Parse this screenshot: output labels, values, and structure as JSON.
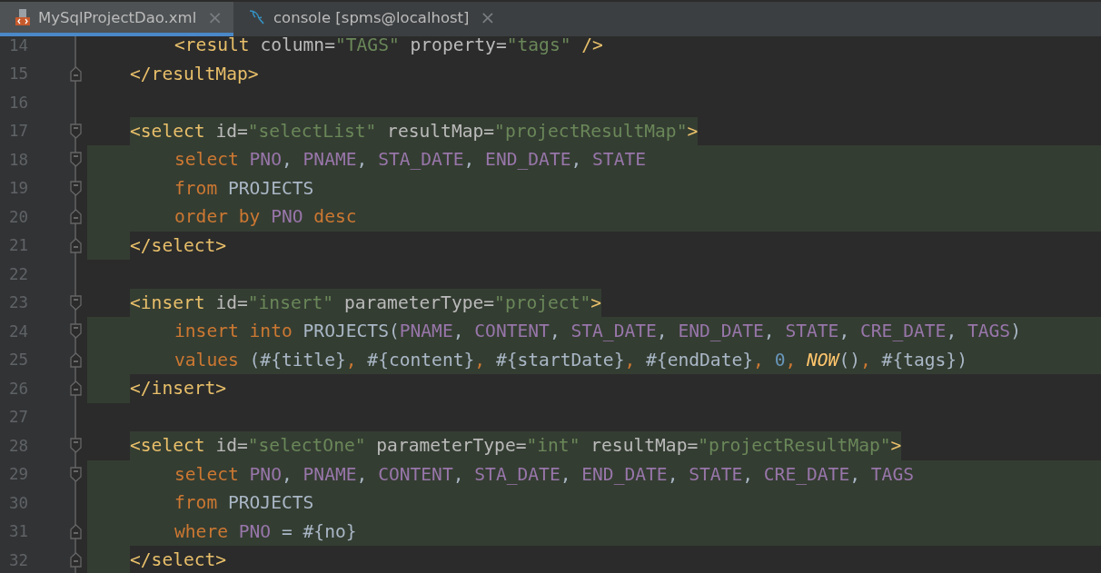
{
  "tabs": [
    {
      "label": "MySqlProjectDao.xml",
      "selected": true,
      "close": "×"
    },
    {
      "label": "console [spms@localhost]",
      "selected": false,
      "close": "×"
    }
  ],
  "lines": [
    {
      "number": "14",
      "kind": "inner",
      "tokens": [
        {
          "kind": "tag",
          "text": "<result "
        },
        {
          "kind": "attr",
          "text": "column="
        },
        {
          "kind": "value",
          "text": "\"TAGS\""
        },
        {
          "kind": "attr",
          "text": " property="
        },
        {
          "kind": "value",
          "text": "\"tags\""
        },
        {
          "kind": "tag",
          "text": " />"
        }
      ]
    },
    {
      "number": "15",
      "kind": "outer",
      "marker": {
        "kind": "end"
      },
      "tokens": [
        {
          "kind": "tag",
          "text": "</resultMap>"
        }
      ]
    },
    {
      "number": "16"
    },
    {
      "number": "17",
      "kind": "outer",
      "marker": {
        "kind": "start"
      },
      "shade": {
        "kind": "tag"
      },
      "tokens": [
        {
          "kind": "tag",
          "text": "<select "
        },
        {
          "kind": "attr",
          "text": "id="
        },
        {
          "kind": "value",
          "text": "\"selectList\""
        },
        {
          "kind": "attr",
          "text": " resultMap="
        },
        {
          "kind": "value",
          "text": "\"projectResultMap\""
        },
        {
          "kind": "tag",
          "text": ">"
        }
      ]
    },
    {
      "number": "18",
      "kind": "inner",
      "marker": {
        "kind": "start"
      },
      "shade": {
        "kind": "full"
      },
      "tokens": [
        {
          "kind": "keyword",
          "text": "select "
        },
        {
          "kind": "column",
          "text": "PNO"
        },
        {
          "kind": "text",
          "text": ", "
        },
        {
          "kind": "column",
          "text": "PNAME"
        },
        {
          "kind": "text",
          "text": ", "
        },
        {
          "kind": "column",
          "text": "STA_DATE"
        },
        {
          "kind": "text",
          "text": ", "
        },
        {
          "kind": "column",
          "text": "END_DATE"
        },
        {
          "kind": "text",
          "text": ", "
        },
        {
          "kind": "column",
          "text": "STATE"
        }
      ]
    },
    {
      "number": "19",
      "kind": "inner",
      "marker": {
        "kind": "start"
      },
      "shade": {
        "kind": "full"
      },
      "tokens": [
        {
          "kind": "keyword",
          "text": "from "
        },
        {
          "kind": "text",
          "text": "PROJECTS"
        }
      ]
    },
    {
      "number": "20",
      "kind": "inner",
      "marker": {
        "kind": "end"
      },
      "shade": {
        "kind": "full"
      },
      "tokens": [
        {
          "kind": "keyword",
          "text": "order by "
        },
        {
          "kind": "column",
          "text": "PNO"
        },
        {
          "kind": "keyword",
          "text": " desc"
        }
      ]
    },
    {
      "number": "21",
      "kind": "outer",
      "marker": {
        "kind": "end"
      },
      "shade": {
        "kind": "margin"
      },
      "tokens": [
        {
          "kind": "tag",
          "text": "</select>"
        }
      ]
    },
    {
      "number": "22"
    },
    {
      "number": "23",
      "kind": "outer",
      "marker": {
        "kind": "start"
      },
      "shade": {
        "kind": "tag"
      },
      "tokens": [
        {
          "kind": "tag",
          "text": "<insert "
        },
        {
          "kind": "attr",
          "text": "id="
        },
        {
          "kind": "value",
          "text": "\"insert\""
        },
        {
          "kind": "attr",
          "text": " parameterType="
        },
        {
          "kind": "value",
          "text": "\"project\""
        },
        {
          "kind": "tag",
          "text": ">"
        }
      ]
    },
    {
      "number": "24",
      "kind": "inner",
      "marker": {
        "kind": "start"
      },
      "shade": {
        "kind": "full"
      },
      "tokens": [
        {
          "kind": "keyword",
          "text": "insert into "
        },
        {
          "kind": "text",
          "text": "PROJECTS("
        },
        {
          "kind": "column",
          "text": "PNAME"
        },
        {
          "kind": "text",
          "text": ", "
        },
        {
          "kind": "column",
          "text": "CONTENT"
        },
        {
          "kind": "text",
          "text": ", "
        },
        {
          "kind": "column",
          "text": "STA_DATE"
        },
        {
          "kind": "text",
          "text": ", "
        },
        {
          "kind": "column",
          "text": "END_DATE"
        },
        {
          "kind": "text",
          "text": ", "
        },
        {
          "kind": "column",
          "text": "STATE"
        },
        {
          "kind": "text",
          "text": ", "
        },
        {
          "kind": "column",
          "text": "CRE_DATE"
        },
        {
          "kind": "text",
          "text": ", "
        },
        {
          "kind": "column",
          "text": "TAGS"
        },
        {
          "kind": "text",
          "text": ")"
        }
      ]
    },
    {
      "number": "25",
      "kind": "inner",
      "marker": {
        "kind": "end"
      },
      "shade": {
        "kind": "full"
      },
      "tokens": [
        {
          "kind": "keyword",
          "text": "values "
        },
        {
          "kind": "text",
          "text": "(#{title}"
        },
        {
          "kind": "keyword",
          "text": ", "
        },
        {
          "kind": "text",
          "text": "#{content}"
        },
        {
          "kind": "keyword",
          "text": ", "
        },
        {
          "kind": "text",
          "text": "#{startDate}"
        },
        {
          "kind": "keyword",
          "text": ", "
        },
        {
          "kind": "text",
          "text": "#{endDate}"
        },
        {
          "kind": "keyword",
          "text": ", "
        },
        {
          "kind": "number",
          "text": "0"
        },
        {
          "kind": "keyword",
          "text": ", "
        },
        {
          "kind": "func",
          "text": "NOW"
        },
        {
          "kind": "text",
          "text": "()"
        },
        {
          "kind": "keyword",
          "text": ", "
        },
        {
          "kind": "text",
          "text": "#{tags})"
        }
      ]
    },
    {
      "number": "26",
      "kind": "outer",
      "marker": {
        "kind": "end"
      },
      "shade": {
        "kind": "margin"
      },
      "tokens": [
        {
          "kind": "tag",
          "text": "</insert>"
        }
      ]
    },
    {
      "number": "27"
    },
    {
      "number": "28",
      "kind": "outer",
      "marker": {
        "kind": "start"
      },
      "shade": {
        "kind": "tag"
      },
      "tokens": [
        {
          "kind": "tag",
          "text": "<select "
        },
        {
          "kind": "attr",
          "text": "id="
        },
        {
          "kind": "value",
          "text": "\"selectOne\""
        },
        {
          "kind": "attr",
          "text": " parameterType="
        },
        {
          "kind": "value",
          "text": "\"int\""
        },
        {
          "kind": "attr",
          "text": " resultMap="
        },
        {
          "kind": "value",
          "text": "\"projectResultMap\""
        },
        {
          "kind": "tag",
          "text": ">"
        }
      ]
    },
    {
      "number": "29",
      "kind": "inner",
      "marker": {
        "kind": "start"
      },
      "shade": {
        "kind": "full"
      },
      "tokens": [
        {
          "kind": "keyword",
          "text": "select "
        },
        {
          "kind": "column",
          "text": "PNO"
        },
        {
          "kind": "text",
          "text": ", "
        },
        {
          "kind": "column",
          "text": "PNAME"
        },
        {
          "kind": "text",
          "text": ", "
        },
        {
          "kind": "column",
          "text": "CONTENT"
        },
        {
          "kind": "text",
          "text": ", "
        },
        {
          "kind": "column",
          "text": "STA_DATE"
        },
        {
          "kind": "text",
          "text": ", "
        },
        {
          "kind": "column",
          "text": "END_DATE"
        },
        {
          "kind": "text",
          "text": ", "
        },
        {
          "kind": "column",
          "text": "STATE"
        },
        {
          "kind": "text",
          "text": ", "
        },
        {
          "kind": "column",
          "text": "CRE_DATE"
        },
        {
          "kind": "text",
          "text": ", "
        },
        {
          "kind": "column",
          "text": "TAGS"
        }
      ]
    },
    {
      "number": "30",
      "kind": "inner",
      "shade": {
        "kind": "full"
      },
      "tokens": [
        {
          "kind": "keyword",
          "text": "from "
        },
        {
          "kind": "text",
          "text": "PROJECTS"
        }
      ]
    },
    {
      "number": "31",
      "kind": "inner",
      "marker": {
        "kind": "end"
      },
      "shade": {
        "kind": "full"
      },
      "tokens": [
        {
          "kind": "keyword",
          "text": "where "
        },
        {
          "kind": "column",
          "text": "PNO"
        },
        {
          "kind": "text",
          "text": " = #{no}"
        }
      ]
    },
    {
      "number": "32",
      "kind": "outer",
      "marker": {
        "kind": "end"
      },
      "shade": {
        "kind": "margin"
      },
      "tokens": [
        {
          "kind": "tag",
          "text": "</select>"
        }
      ]
    }
  ]
}
